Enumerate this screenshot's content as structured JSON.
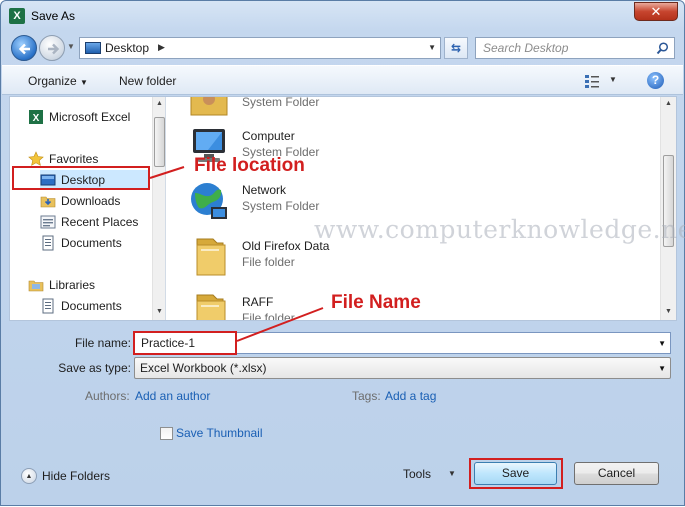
{
  "window": {
    "title": "Save As",
    "app_icon_letter": "X",
    "close_label": "✕"
  },
  "address": {
    "path": "Desktop",
    "search_placeholder": "Search Desktop"
  },
  "toolbar": {
    "organize": "Organize",
    "new_folder": "New folder",
    "help": "?"
  },
  "nav_pane": {
    "items": [
      {
        "label": "Microsoft Excel",
        "icon": "excel-icon"
      },
      {
        "label": "Favorites",
        "icon": "star-icon"
      },
      {
        "label": "Desktop",
        "icon": "desktop-icon",
        "selected": true
      },
      {
        "label": "Downloads",
        "icon": "downloads-folder-icon"
      },
      {
        "label": "Recent Places",
        "icon": "recent-places-icon"
      },
      {
        "label": "Documents",
        "icon": "documents-icon"
      },
      {
        "label": "Libraries",
        "icon": "libraries-icon"
      },
      {
        "label": "Documents",
        "icon": "documents-icon"
      }
    ]
  },
  "files": [
    {
      "name": "",
      "type": "System Folder",
      "icon": "user-folder-icon"
    },
    {
      "name": "Computer",
      "type": "System Folder",
      "icon": "computer-icon"
    },
    {
      "name": "Network",
      "type": "System Folder",
      "icon": "network-icon"
    },
    {
      "name": "Old Firefox Data",
      "type": "File folder",
      "icon": "folder-icon"
    },
    {
      "name": "RAFF",
      "type": "File folder",
      "icon": "folder-icon"
    }
  ],
  "watermark": "www.computerknowledge.net",
  "form": {
    "file_name_label": "File name:",
    "file_name_value": "Practice-1",
    "save_type_label": "Save as type:",
    "save_type_value": "Excel Workbook (*.xlsx)",
    "authors_label": "Authors:",
    "authors_link": "Add an author",
    "tags_label": "Tags:",
    "tags_link": "Add a tag",
    "thumbnail_label": "Save Thumbnail",
    "thumbnail_checked": false
  },
  "footer": {
    "hide_folders": "Hide Folders",
    "tools": "Tools",
    "save": "Save",
    "cancel": "Cancel"
  },
  "annotations": {
    "file_location": "File location",
    "file_name": "File Name",
    "color": "#d21f1f"
  }
}
